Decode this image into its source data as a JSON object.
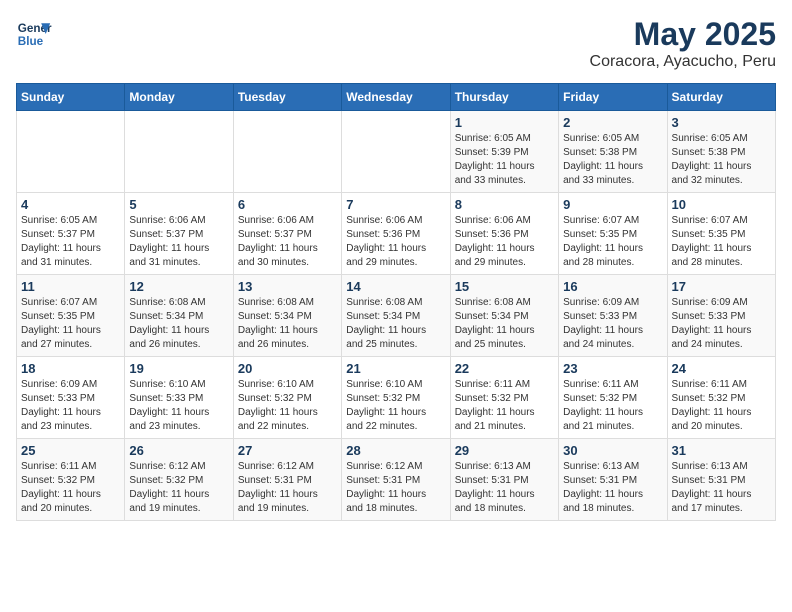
{
  "logo": {
    "line1": "General",
    "line2": "Blue"
  },
  "title": "May 2025",
  "subtitle": "Coracora, Ayacucho, Peru",
  "weekdays": [
    "Sunday",
    "Monday",
    "Tuesday",
    "Wednesday",
    "Thursday",
    "Friday",
    "Saturday"
  ],
  "weeks": [
    [
      {
        "day": "",
        "info": ""
      },
      {
        "day": "",
        "info": ""
      },
      {
        "day": "",
        "info": ""
      },
      {
        "day": "",
        "info": ""
      },
      {
        "day": "1",
        "info": "Sunrise: 6:05 AM\nSunset: 5:39 PM\nDaylight: 11 hours\nand 33 minutes."
      },
      {
        "day": "2",
        "info": "Sunrise: 6:05 AM\nSunset: 5:38 PM\nDaylight: 11 hours\nand 33 minutes."
      },
      {
        "day": "3",
        "info": "Sunrise: 6:05 AM\nSunset: 5:38 PM\nDaylight: 11 hours\nand 32 minutes."
      }
    ],
    [
      {
        "day": "4",
        "info": "Sunrise: 6:05 AM\nSunset: 5:37 PM\nDaylight: 11 hours\nand 31 minutes."
      },
      {
        "day": "5",
        "info": "Sunrise: 6:06 AM\nSunset: 5:37 PM\nDaylight: 11 hours\nand 31 minutes."
      },
      {
        "day": "6",
        "info": "Sunrise: 6:06 AM\nSunset: 5:37 PM\nDaylight: 11 hours\nand 30 minutes."
      },
      {
        "day": "7",
        "info": "Sunrise: 6:06 AM\nSunset: 5:36 PM\nDaylight: 11 hours\nand 29 minutes."
      },
      {
        "day": "8",
        "info": "Sunrise: 6:06 AM\nSunset: 5:36 PM\nDaylight: 11 hours\nand 29 minutes."
      },
      {
        "day": "9",
        "info": "Sunrise: 6:07 AM\nSunset: 5:35 PM\nDaylight: 11 hours\nand 28 minutes."
      },
      {
        "day": "10",
        "info": "Sunrise: 6:07 AM\nSunset: 5:35 PM\nDaylight: 11 hours\nand 28 minutes."
      }
    ],
    [
      {
        "day": "11",
        "info": "Sunrise: 6:07 AM\nSunset: 5:35 PM\nDaylight: 11 hours\nand 27 minutes."
      },
      {
        "day": "12",
        "info": "Sunrise: 6:08 AM\nSunset: 5:34 PM\nDaylight: 11 hours\nand 26 minutes."
      },
      {
        "day": "13",
        "info": "Sunrise: 6:08 AM\nSunset: 5:34 PM\nDaylight: 11 hours\nand 26 minutes."
      },
      {
        "day": "14",
        "info": "Sunrise: 6:08 AM\nSunset: 5:34 PM\nDaylight: 11 hours\nand 25 minutes."
      },
      {
        "day": "15",
        "info": "Sunrise: 6:08 AM\nSunset: 5:34 PM\nDaylight: 11 hours\nand 25 minutes."
      },
      {
        "day": "16",
        "info": "Sunrise: 6:09 AM\nSunset: 5:33 PM\nDaylight: 11 hours\nand 24 minutes."
      },
      {
        "day": "17",
        "info": "Sunrise: 6:09 AM\nSunset: 5:33 PM\nDaylight: 11 hours\nand 24 minutes."
      }
    ],
    [
      {
        "day": "18",
        "info": "Sunrise: 6:09 AM\nSunset: 5:33 PM\nDaylight: 11 hours\nand 23 minutes."
      },
      {
        "day": "19",
        "info": "Sunrise: 6:10 AM\nSunset: 5:33 PM\nDaylight: 11 hours\nand 23 minutes."
      },
      {
        "day": "20",
        "info": "Sunrise: 6:10 AM\nSunset: 5:32 PM\nDaylight: 11 hours\nand 22 minutes."
      },
      {
        "day": "21",
        "info": "Sunrise: 6:10 AM\nSunset: 5:32 PM\nDaylight: 11 hours\nand 22 minutes."
      },
      {
        "day": "22",
        "info": "Sunrise: 6:11 AM\nSunset: 5:32 PM\nDaylight: 11 hours\nand 21 minutes."
      },
      {
        "day": "23",
        "info": "Sunrise: 6:11 AM\nSunset: 5:32 PM\nDaylight: 11 hours\nand 21 minutes."
      },
      {
        "day": "24",
        "info": "Sunrise: 6:11 AM\nSunset: 5:32 PM\nDaylight: 11 hours\nand 20 minutes."
      }
    ],
    [
      {
        "day": "25",
        "info": "Sunrise: 6:11 AM\nSunset: 5:32 PM\nDaylight: 11 hours\nand 20 minutes."
      },
      {
        "day": "26",
        "info": "Sunrise: 6:12 AM\nSunset: 5:32 PM\nDaylight: 11 hours\nand 19 minutes."
      },
      {
        "day": "27",
        "info": "Sunrise: 6:12 AM\nSunset: 5:31 PM\nDaylight: 11 hours\nand 19 minutes."
      },
      {
        "day": "28",
        "info": "Sunrise: 6:12 AM\nSunset: 5:31 PM\nDaylight: 11 hours\nand 18 minutes."
      },
      {
        "day": "29",
        "info": "Sunrise: 6:13 AM\nSunset: 5:31 PM\nDaylight: 11 hours\nand 18 minutes."
      },
      {
        "day": "30",
        "info": "Sunrise: 6:13 AM\nSunset: 5:31 PM\nDaylight: 11 hours\nand 18 minutes."
      },
      {
        "day": "31",
        "info": "Sunrise: 6:13 AM\nSunset: 5:31 PM\nDaylight: 11 hours\nand 17 minutes."
      }
    ]
  ]
}
